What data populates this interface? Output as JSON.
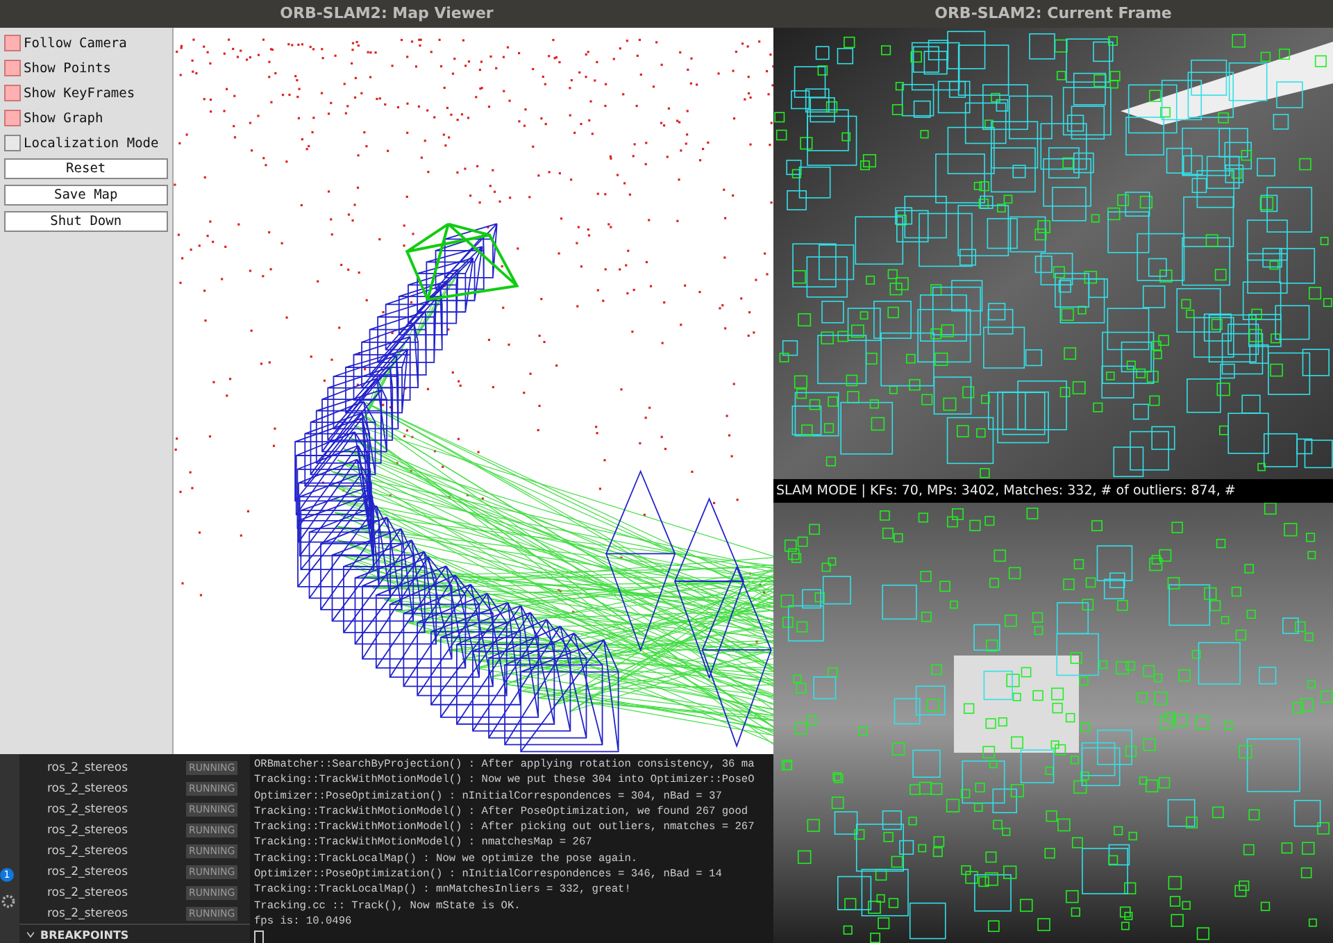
{
  "map_viewer": {
    "title": "ORB-SLAM2: Map Viewer",
    "options": [
      {
        "label": "Follow Camera",
        "checked": true
      },
      {
        "label": "Show Points",
        "checked": true
      },
      {
        "label": "Show KeyFrames",
        "checked": true
      },
      {
        "label": "Show Graph",
        "checked": true
      },
      {
        "label": "Localization Mode",
        "checked": false
      }
    ],
    "buttons": [
      "Reset",
      "Save Map",
      "Shut Down"
    ]
  },
  "debug_sidebar": {
    "badge": "1",
    "processes": [
      {
        "name": "ros_2_stereos",
        "status": "RUNNING"
      },
      {
        "name": "ros_2_stereos",
        "status": "RUNNING"
      },
      {
        "name": "ros_2_stereos",
        "status": "RUNNING"
      },
      {
        "name": "ros_2_stereos",
        "status": "RUNNING"
      },
      {
        "name": "ros_2_stereos",
        "status": "RUNNING"
      },
      {
        "name": "ros_2_stereos",
        "status": "RUNNING"
      },
      {
        "name": "ros_2_stereos",
        "status": "RUNNING"
      },
      {
        "name": "ros_2_stereos",
        "status": "RUNNING"
      }
    ],
    "section": "BREAKPOINTS"
  },
  "terminal": {
    "lines": [
      "ORBmatcher::SearchByProjection() : After applying rotation consistency, 36 ma",
      "Tracking::TrackWithMotionModel() : Now we put these 304 into Optimizer::PoseO",
      "Optimizer::PoseOptimization() : nInitialCorrespondences = 304, nBad = 37",
      "Tracking::TrackWithMotionModel() : After PoseOptimization, we found 267 good",
      "Tracking::TrackWithMotionModel() : After picking out outliers, nmatches = 267",
      "Tracking::TrackWithMotionModel() : nmatchesMap = 267",
      "Tracking::TrackLocalMap() : Now we optimize the pose again.",
      "Optimizer::PoseOptimization() : nInitialCorrespondences = 346, nBad = 14",
      "Tracking::TrackLocalMap() : mnMatchesInliers = 332, great!",
      "Tracking.cc :: Track(), Now mState is OK.",
      "fps is: 10.0496"
    ]
  },
  "current_frame": {
    "title": "ORB-SLAM2: Current Frame",
    "status": "SLAM MODE |  KFs: 70, MPs: 3402, Matches: 332, # of outliers: 874, #"
  }
}
